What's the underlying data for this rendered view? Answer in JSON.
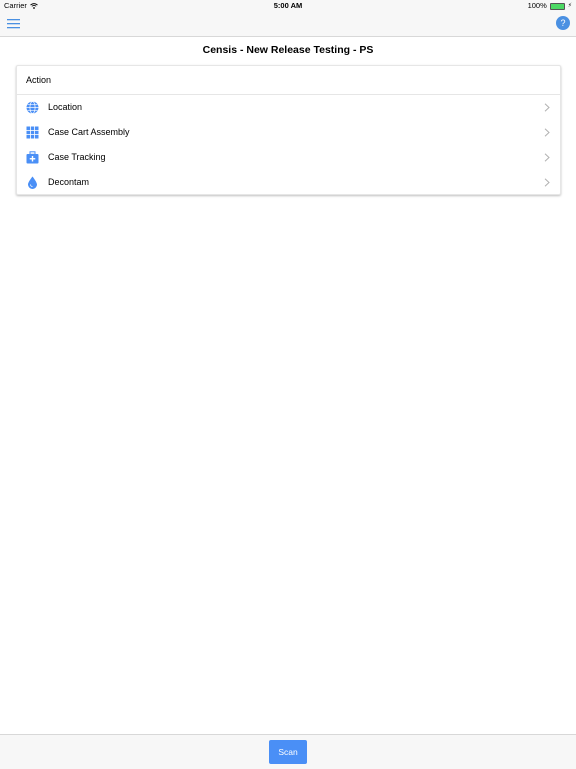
{
  "status_bar": {
    "carrier": "Carrier",
    "time": "5:00 AM",
    "battery": "100%"
  },
  "nav": {
    "menu_icon": "hamburger-menu-icon",
    "help_label": "?",
    "accent_color": "#4a90e2"
  },
  "page": {
    "title": "Censis - New Release Testing - PS"
  },
  "action_card": {
    "header": "Action",
    "items": [
      {
        "label": "Location",
        "icon": "globe-icon"
      },
      {
        "label": "Case Cart Assembly",
        "icon": "grid-icon"
      },
      {
        "label": "Case Tracking",
        "icon": "medical-case-icon"
      },
      {
        "label": "Decontam",
        "icon": "water-drop-icon"
      }
    ]
  },
  "bottom_bar": {
    "scan_label": "Scan",
    "scan_color": "#4a8ff6"
  }
}
